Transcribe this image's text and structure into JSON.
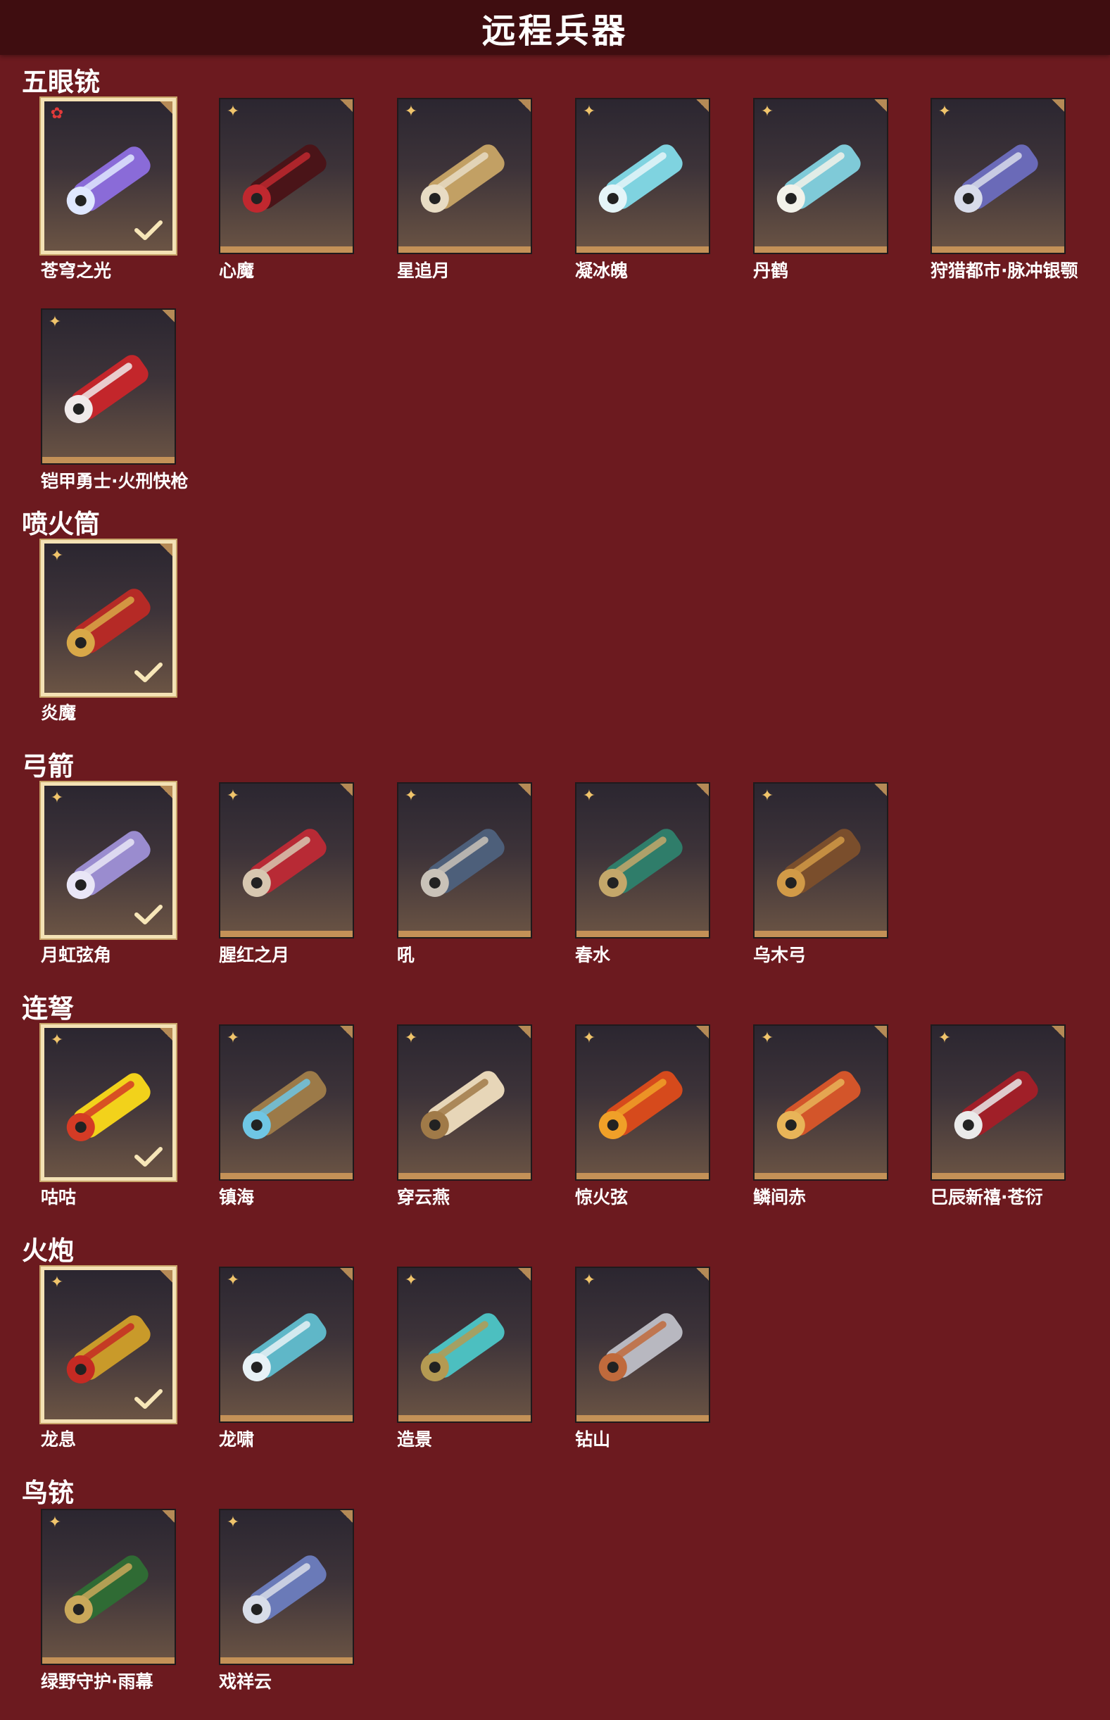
{
  "header": {
    "title": "远程兵器"
  },
  "sections": [
    {
      "title": "五眼铳",
      "items": [
        {
          "name": "苍穹之光",
          "selected": true,
          "badge": "star",
          "icon": "violet-quad-barrel-gun-icon"
        },
        {
          "name": "心魔",
          "selected": false,
          "badge": "clover",
          "icon": "dark-red-demon-gun-icon"
        },
        {
          "name": "星追月",
          "selected": false,
          "badge": "clover",
          "icon": "gold-quad-barrel-gun-icon"
        },
        {
          "name": "凝冰魄",
          "selected": false,
          "badge": "clover",
          "icon": "ice-quad-barrel-gun-icon"
        },
        {
          "name": "丹鹤",
          "selected": false,
          "badge": "clover",
          "icon": "crane-quad-barrel-gun-icon"
        },
        {
          "name": "狩猎都市·脉冲银颚",
          "selected": false,
          "badge": "clover",
          "icon": "silver-jaw-pulse-gun-icon"
        },
        {
          "name": "铠甲勇士·火刑快枪",
          "selected": false,
          "badge": "clover",
          "icon": "red-armor-gatling-icon"
        }
      ]
    },
    {
      "title": "喷火筒",
      "items": [
        {
          "name": "炎魔",
          "selected": true,
          "badge": "clover",
          "icon": "flame-demon-cannon-icon"
        }
      ]
    },
    {
      "title": "弓箭",
      "items": [
        {
          "name": "月虹弦角",
          "selected": true,
          "badge": "clover",
          "icon": "lunar-rainbow-bow-icon"
        },
        {
          "name": "腥红之月",
          "selected": false,
          "badge": "clover",
          "icon": "crimson-moon-bow-icon"
        },
        {
          "name": "吼",
          "selected": false,
          "badge": "clover",
          "icon": "roar-bow-icon"
        },
        {
          "name": "春水",
          "selected": false,
          "badge": "clover",
          "icon": "jade-spring-bow-icon"
        },
        {
          "name": "乌木弓",
          "selected": false,
          "badge": "clover",
          "icon": "ebony-bow-icon"
        }
      ]
    },
    {
      "title": "连弩",
      "items": [
        {
          "name": "咕咕",
          "selected": true,
          "badge": "clover",
          "icon": "rubber-chicken-crossbow-icon"
        },
        {
          "name": "镇海",
          "selected": false,
          "badge": "clover",
          "icon": "sea-guard-crossbow-icon"
        },
        {
          "name": "穿云燕",
          "selected": false,
          "badge": "clover",
          "icon": "cloud-swallow-crossbow-icon"
        },
        {
          "name": "惊火弦",
          "selected": false,
          "badge": "clover",
          "icon": "fire-string-crossbow-icon"
        },
        {
          "name": "鳞间赤",
          "selected": false,
          "badge": "clover",
          "icon": "red-koi-crossbow-icon"
        },
        {
          "name": "巳辰新禧·苍衍",
          "selected": false,
          "badge": "clover",
          "icon": "serpent-dragon-crossbow-icon"
        }
      ]
    },
    {
      "title": "火炮",
      "items": [
        {
          "name": "龙息",
          "selected": true,
          "badge": "clover",
          "icon": "golden-dragon-cannon-icon"
        },
        {
          "name": "龙啸",
          "selected": false,
          "badge": "clover",
          "icon": "azure-dragon-cannon-icon"
        },
        {
          "name": "造景",
          "selected": false,
          "badge": "clover",
          "icon": "jade-lion-cannon-icon"
        },
        {
          "name": "钻山",
          "selected": false,
          "badge": "clover",
          "icon": "drill-mountain-cannon-icon"
        }
      ]
    },
    {
      "title": "鸟铳",
      "items": [
        {
          "name": "绿野守护·雨幕",
          "selected": false,
          "badge": "clover",
          "icon": "green-guardian-musket-icon"
        },
        {
          "name": "戏祥云",
          "selected": false,
          "badge": "clover",
          "icon": "auspicious-cloud-musket-icon"
        }
      ]
    }
  ],
  "palette": {
    "background": "#6c1a1f",
    "header": "#3f0d10",
    "tile_top": "#2b2630",
    "tile_bottom": "#6b5444",
    "tile_bar": "#c49157",
    "selected_border": "#f4e2b5",
    "badge": "#f0c46b",
    "badge_star": "#e23a3a"
  }
}
